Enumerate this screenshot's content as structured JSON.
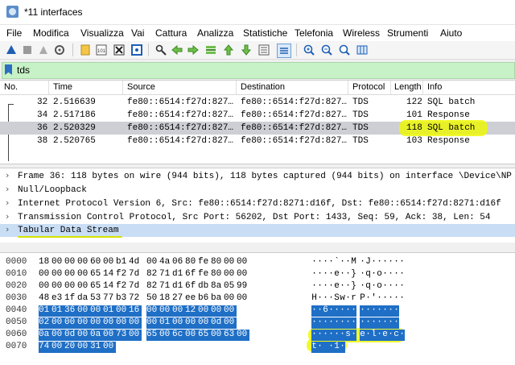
{
  "window": {
    "title": "*11 interfaces"
  },
  "menu": [
    "File",
    "Modifica",
    "Visualizza",
    "Vai",
    "Cattura",
    "Analizza",
    "Statistiche",
    "Telefonia",
    "Wireless",
    "Strumenti",
    "Aiuto"
  ],
  "toolbar": {
    "icons": [
      "shark-fin-start-icon",
      "stop-icon",
      "restart-icon",
      "capture-options-icon",
      "open-file-icon",
      "save-file-icon",
      "close-file-icon",
      "reload-icon",
      "find-packet-icon",
      "go-back-icon",
      "go-forward-icon",
      "go-to-packet-icon",
      "go-first-icon",
      "go-last-icon",
      "autoscroll-icon",
      "colorize-icon",
      "zoom-in-icon",
      "zoom-out-icon",
      "zoom-reset-icon",
      "resize-columns-icon"
    ]
  },
  "filter": {
    "value": "tds"
  },
  "packet_list": {
    "columns": [
      "No.",
      "Time",
      "Source",
      "Destination",
      "Protocol",
      "Length",
      "Info"
    ],
    "rows": [
      {
        "no": "32",
        "time": "2.516639",
        "src": "fe80::6514:f27d:827…",
        "dst": "fe80::6514:f27d:827…",
        "proto": "TDS",
        "len": "122",
        "info": "SQL batch",
        "selected": false
      },
      {
        "no": "34",
        "time": "2.517186",
        "src": "fe80::6514:f27d:827…",
        "dst": "fe80::6514:f27d:827…",
        "proto": "TDS",
        "len": "101",
        "info": "Response",
        "selected": false
      },
      {
        "no": "36",
        "time": "2.520329",
        "src": "fe80::6514:f27d:827…",
        "dst": "fe80::6514:f27d:827…",
        "proto": "TDS",
        "len": "118",
        "info": "SQL batch",
        "selected": true
      },
      {
        "no": "38",
        "time": "2.520765",
        "src": "fe80::6514:f27d:827…",
        "dst": "fe80::6514:f27d:827…",
        "proto": "TDS",
        "len": "103",
        "info": "Response",
        "selected": false
      }
    ]
  },
  "details": [
    {
      "text": "Frame 36: 118 bytes on wire (944 bits), 118 bytes captured (944 bits) on interface \\Device\\NP",
      "selected": false
    },
    {
      "text": "Null/Loopback",
      "selected": false
    },
    {
      "text": "Internet Protocol Version 6, Src: fe80::6514:f27d:8271:d16f, Dst: fe80::6514:f27d:8271:d16f",
      "selected": false
    },
    {
      "text": "Transmission Control Protocol, Src Port: 56202, Dst Port: 1433, Seq: 59, Ack: 38, Len: 54",
      "selected": false
    },
    {
      "text": "Tabular Data Stream",
      "selected": true
    }
  ],
  "hex": {
    "rows": [
      {
        "offset": "0000",
        "bytes": [
          "18",
          "00",
          "00",
          "00",
          "60",
          "00",
          "b1",
          "4d",
          "00",
          "4a",
          "06",
          "80",
          "fe",
          "80",
          "00",
          "00"
        ],
        "ascii": [
          "·",
          "·",
          "·",
          "·",
          "`",
          "·",
          "·",
          "M",
          "·",
          "J",
          "·",
          "·",
          "·",
          "·",
          "·",
          "·"
        ],
        "sel_from": 99
      },
      {
        "offset": "0010",
        "bytes": [
          "00",
          "00",
          "00",
          "00",
          "65",
          "14",
          "f2",
          "7d",
          "82",
          "71",
          "d1",
          "6f",
          "fe",
          "80",
          "00",
          "00"
        ],
        "ascii": [
          "·",
          "·",
          "·",
          "·",
          "e",
          "·",
          "·",
          "}",
          "·",
          "q",
          "·",
          "o",
          "·",
          "·",
          "·",
          "·"
        ],
        "sel_from": 99
      },
      {
        "offset": "0020",
        "bytes": [
          "00",
          "00",
          "00",
          "00",
          "65",
          "14",
          "f2",
          "7d",
          "82",
          "71",
          "d1",
          "6f",
          "db",
          "8a",
          "05",
          "99"
        ],
        "ascii": [
          "·",
          "·",
          "·",
          "·",
          "e",
          "·",
          "·",
          "}",
          "·",
          "q",
          "·",
          "o",
          "·",
          "·",
          "·",
          "·"
        ],
        "sel_from": 99
      },
      {
        "offset": "0030",
        "bytes": [
          "48",
          "e3",
          "1f",
          "da",
          "53",
          "77",
          "b3",
          "72",
          "50",
          "18",
          "27",
          "ee",
          "b6",
          "ba",
          "00",
          "00"
        ],
        "ascii": [
          "H",
          "·",
          "·",
          "·",
          "S",
          "w",
          "·",
          "r",
          "P",
          "·",
          "'",
          "·",
          "·",
          "·",
          "·",
          "·"
        ],
        "sel_from": 99
      },
      {
        "offset": "0040",
        "bytes": [
          "01",
          "01",
          "36",
          "00",
          "00",
          "01",
          "00",
          "16",
          "00",
          "00",
          "00",
          "12",
          "00",
          "00",
          "00"
        ],
        "ascii": [
          "·",
          "·",
          "6",
          "·",
          "·",
          "·",
          "·",
          "·",
          "·",
          "·",
          "·",
          "·",
          "·",
          "·",
          "·"
        ],
        "sel_from": 0
      },
      {
        "offset": "0050",
        "bytes": [
          "02",
          "00",
          "00",
          "00",
          "00",
          "00",
          "00",
          "00",
          "00",
          "01",
          "00",
          "00",
          "00",
          "0d",
          "00"
        ],
        "ascii": [
          "·",
          "·",
          "·",
          "·",
          "·",
          "·",
          "·",
          "·",
          "·",
          "·",
          "·",
          "·",
          "·",
          "·",
          "·"
        ],
        "sel_from": 0
      },
      {
        "offset": "0060",
        "bytes": [
          "0a",
          "00",
          "0d",
          "00",
          "0a",
          "00",
          "73",
          "00",
          "65",
          "00",
          "6c",
          "00",
          "65",
          "00",
          "63",
          "00"
        ],
        "ascii": [
          "·",
          "·",
          "·",
          "·",
          "·",
          "·",
          "s",
          "·",
          "e",
          "·",
          "l",
          "·",
          "e",
          "·",
          "c",
          "·"
        ],
        "sel_from": 0
      },
      {
        "offset": "0070",
        "bytes": [
          "74",
          "00",
          "20",
          "00",
          "31",
          "00"
        ],
        "ascii": [
          "t",
          "·",
          " ",
          "·",
          "1",
          "·"
        ],
        "sel_from": 0
      }
    ]
  },
  "colors": {
    "filter_bg": "#c7f2c7",
    "selected_packet": "#cdcfd5",
    "selected_detail": "#c9def5",
    "hex_selection": "#1f6fc6",
    "highlighter": "#eef800"
  }
}
